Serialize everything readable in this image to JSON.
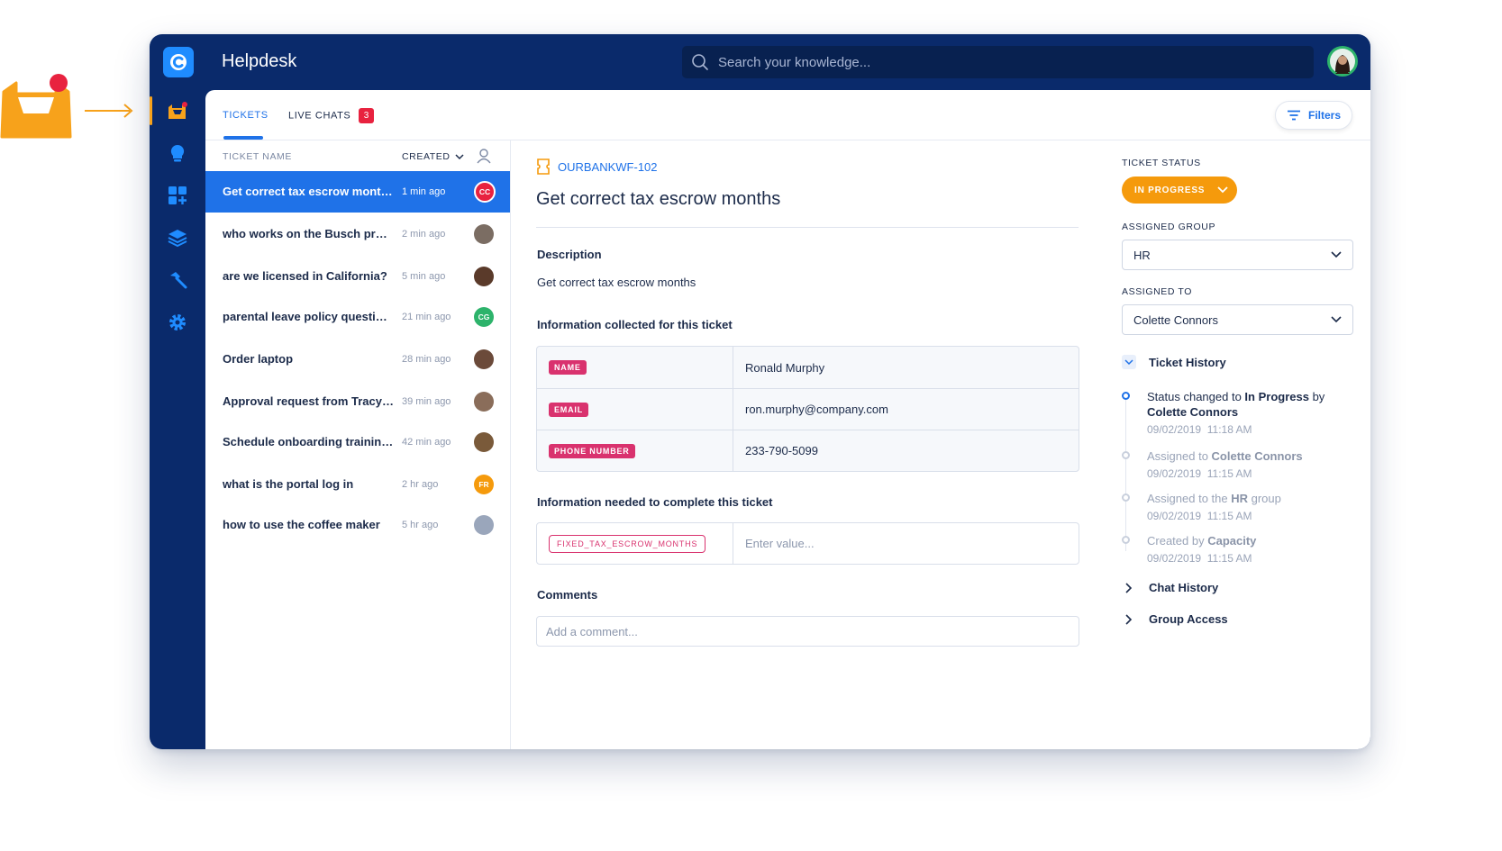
{
  "app": {
    "title": "Helpdesk"
  },
  "search": {
    "placeholder": "Search your knowledge..."
  },
  "tabs": [
    {
      "label": "TICKETS",
      "active": true
    },
    {
      "label": "LIVE CHATS",
      "badge": "3"
    }
  ],
  "filters": {
    "label": "Filters"
  },
  "list": {
    "headers": {
      "name": "TICKET NAME",
      "created": "CREATED"
    },
    "rows": [
      {
        "title": "Get correct tax escrow months",
        "time": "1 min ago",
        "avatar": "CC",
        "avatar_color": "#e8223f",
        "active": true
      },
      {
        "title": "who works on the Busch proj…",
        "time": "2 min ago",
        "avatar": "",
        "avatar_color": "#7b6d63"
      },
      {
        "title": "are we licensed in California?",
        "time": "5 min ago",
        "avatar": "",
        "avatar_color": "#5a3a2a"
      },
      {
        "title": "parental leave policy questio…",
        "time": "21 min ago",
        "avatar": "CG",
        "avatar_color": "#2db36b"
      },
      {
        "title": "Order laptop",
        "time": "28 min ago",
        "avatar": "",
        "avatar_color": "#6b4a3a"
      },
      {
        "title": "Approval request from Tracy…",
        "time": "39 min ago",
        "avatar": "",
        "avatar_color": "#8a6d5a"
      },
      {
        "title": "Schedule onboarding trainin…",
        "time": "42 min ago",
        "avatar": "",
        "avatar_color": "#7a5a3a"
      },
      {
        "title": "what is the portal log in",
        "time": "2 hr ago",
        "avatar": "FR",
        "avatar_color": "#f59a0c"
      },
      {
        "title": "how to use the coffee maker",
        "time": "5 hr ago",
        "avatar": "",
        "avatar_color": "#9aa6bb"
      }
    ]
  },
  "ticket": {
    "id": "OURBANKWF-102",
    "title": "Get correct tax escrow months",
    "description_label": "Description",
    "description": "Get correct tax escrow months",
    "collected_label": "Information collected for this ticket",
    "collected": [
      {
        "key": "NAME",
        "value": "Ronald Murphy"
      },
      {
        "key": "EMAIL",
        "value": "ron.murphy@company.com"
      },
      {
        "key": "PHONE NUMBER",
        "value": "233-790-5099"
      }
    ],
    "needed_label": "Information needed to complete this ticket",
    "needed": [
      {
        "key": "FIXED_TAX_ESCROW_MONTHS",
        "placeholder": "Enter value..."
      }
    ],
    "comments_label": "Comments",
    "comment_placeholder": "Add a comment..."
  },
  "side": {
    "status_label": "TICKET STATUS",
    "status_value": "IN PROGRESS",
    "group_label": "ASSIGNED GROUP",
    "group_value": "HR",
    "assignee_label": "ASSIGNED TO",
    "assignee_value": "Colette Connors",
    "history_title": "Ticket History",
    "history": [
      {
        "pre": "Status changed to ",
        "bold": "In Progress",
        "mid": " by ",
        "bold2": "Colette Connors",
        "date": "09/02/2019",
        "time": "11:18 AM",
        "current": true
      },
      {
        "pre": "Assigned to ",
        "bold": "Colette Connors",
        "mid": "",
        "bold2": "",
        "date": "09/02/2019",
        "time": "11:15 AM"
      },
      {
        "pre": "Assigned to the ",
        "bold": "HR",
        "mid": " group",
        "bold2": "",
        "date": "09/02/2019",
        "time": "11:15 AM"
      },
      {
        "pre": "Created by ",
        "bold": "Capacity",
        "mid": "",
        "bold2": "",
        "date": "09/02/2019",
        "time": "11:15 AM"
      }
    ],
    "chat_history": "Chat History",
    "group_access": "Group Access"
  },
  "colors": {
    "navy": "#0a2a6b",
    "accent": "#1f72e8",
    "orange": "#f59a0c",
    "tag": "#d9326e",
    "alert": "#e8223f"
  }
}
